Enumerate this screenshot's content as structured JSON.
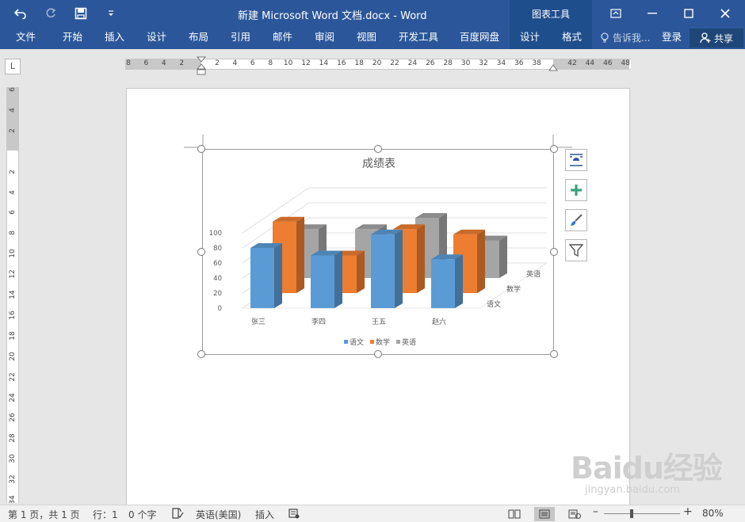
{
  "window": {
    "title": "新建 Microsoft Word 文档.docx - Word",
    "context_tool_header": "图表工具"
  },
  "ribbon": {
    "tabs": [
      "文件",
      "开始",
      "插入",
      "设计",
      "布局",
      "引用",
      "邮件",
      "审阅",
      "视图",
      "开发工具",
      "百度网盘",
      "设计",
      "格式"
    ],
    "tell_me": "告诉我...",
    "login": "登录",
    "share": "共享"
  },
  "ruler": {
    "horizontal_ticks": [
      "8",
      "6",
      "4",
      "2",
      "",
      "2",
      "4",
      "6",
      "8",
      "10",
      "12",
      "14",
      "16",
      "18",
      "20",
      "22",
      "24",
      "26",
      "28",
      "30",
      "32",
      "34",
      "36",
      "38",
      "",
      "42",
      "44",
      "46",
      "48"
    ],
    "vertical_ticks": [
      "6",
      "4",
      "2",
      "",
      "2",
      "4",
      "6",
      "8",
      "10",
      "12",
      "14",
      "16",
      "18",
      "20",
      "22",
      "24",
      "26",
      "28",
      "30",
      "32",
      "34"
    ]
  },
  "chart_data": {
    "type": "bar",
    "title": "成绩表",
    "categories": [
      "张三",
      "李四",
      "王五",
      "赵六"
    ],
    "series": [
      {
        "name": "语文",
        "values": [
          80,
          70,
          98,
          65
        ],
        "color": "#5b9bd5"
      },
      {
        "name": "数学",
        "values": [
          95,
          50,
          85,
          78
        ],
        "color": "#ed7d31"
      },
      {
        "name": "英语",
        "values": [
          65,
          65,
          80,
          50
        ],
        "color": "#a5a5a5"
      }
    ],
    "depth_labels": [
      "语文",
      "数学",
      "英语"
    ],
    "y_ticks": [
      "0",
      "20",
      "40",
      "60",
      "80",
      "100"
    ],
    "ylim": [
      0,
      100
    ],
    "legend_position": "bottom"
  },
  "status": {
    "page": "第 1 页，共 1 页",
    "row": "行：1",
    "words": "0 个字",
    "language": "英语(美国)",
    "mode": "插入",
    "zoom": "80%",
    "zoom_value": 0.8
  },
  "watermark": {
    "logo": "Baidu经验",
    "sub": "jingyan.baidu.com"
  },
  "colors": {
    "ribbon": "#2b579a",
    "context_tab": "#1f4e8c"
  }
}
